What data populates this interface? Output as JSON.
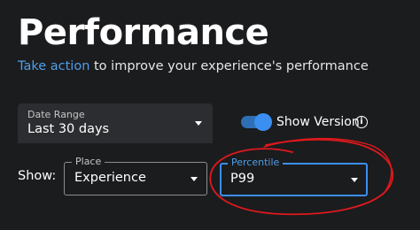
{
  "header": {
    "title": "Performance",
    "subtitle_link": "Take action",
    "subtitle_rest": " to improve your experience's performance"
  },
  "date_range": {
    "label": "Date Range",
    "value": "Last 30 days"
  },
  "show_version": {
    "label": "Show Version",
    "enabled": true,
    "info_glyph": "i"
  },
  "filters": {
    "show_label": "Show:",
    "place": {
      "legend": "Place",
      "value": "Experience"
    },
    "percentile": {
      "legend": "Percentile",
      "value": "P99"
    }
  },
  "colors": {
    "background": "#1b1c1e",
    "accent": "#3b8ff0",
    "link": "#4f9fe9",
    "annotation": "#e0191c"
  }
}
